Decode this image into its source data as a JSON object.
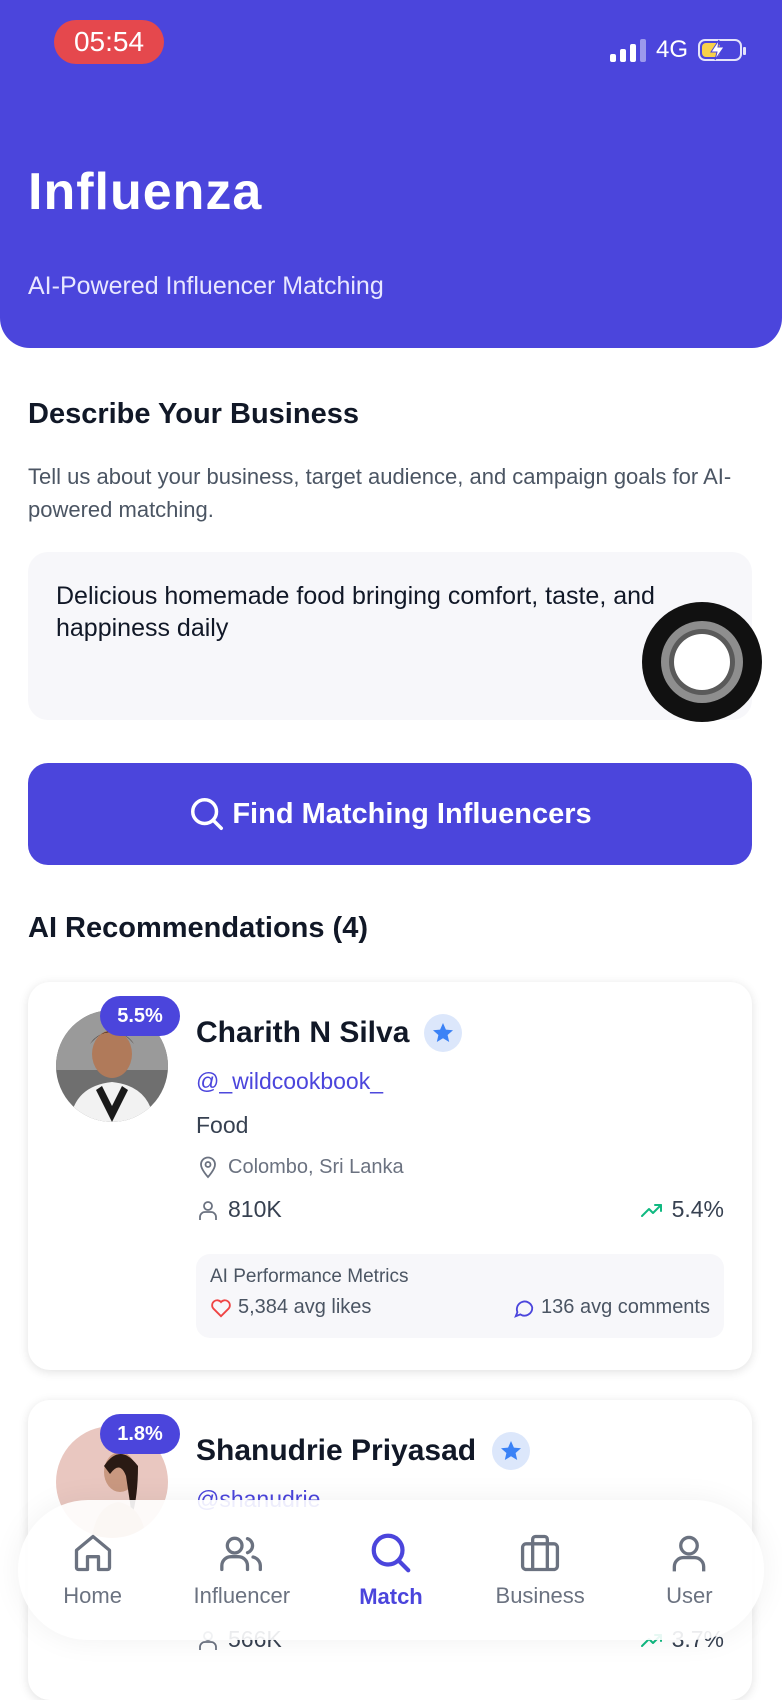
{
  "status_bar": {
    "time": "05:54",
    "network": "4G"
  },
  "header": {
    "title": "Influenza",
    "subtitle": "AI-Powered Influencer Matching"
  },
  "describe": {
    "title": "Describe Your Business",
    "description": "Tell us about your business, target audience, and campaign goals for AI-powered matching.",
    "input_value": "Delicious homemade food bringing comfort, taste, and happiness daily"
  },
  "find_button": {
    "label": "Find Matching Influencers"
  },
  "recommendations": {
    "title": "AI Recommendations (4)",
    "items": [
      {
        "engagement": "5.5%",
        "name": "Charith N Silva",
        "handle": "@_wildcookbook_",
        "category": "Food",
        "location": "Colombo, Sri Lanka",
        "followers": "810K",
        "growth": "5.4%",
        "metrics_title": "AI Performance Metrics",
        "avg_likes": "5,384 avg likes",
        "avg_comments": "136 avg comments"
      },
      {
        "engagement": "1.8%",
        "name": "Shanudrie Priyasad",
        "handle": "@shanudrie",
        "followers": "566K",
        "growth": "3.7%"
      }
    ]
  },
  "tabbar": {
    "items": [
      {
        "label": "Home",
        "icon": "home-icon"
      },
      {
        "label": "Influencer",
        "icon": "users-icon"
      },
      {
        "label": "Match",
        "icon": "search-icon"
      },
      {
        "label": "Business",
        "icon": "briefcase-icon"
      },
      {
        "label": "User",
        "icon": "user-icon"
      }
    ],
    "active": "Match"
  },
  "colors": {
    "primary": "#4B45DC",
    "time_pill": "#E5484D",
    "growth_green": "#10B981",
    "heart_red": "#EF4444"
  }
}
